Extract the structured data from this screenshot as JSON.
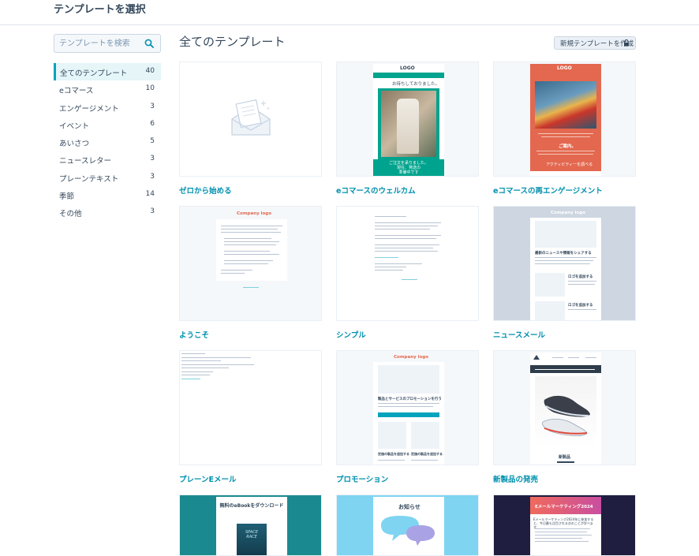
{
  "header": {
    "title": "テンプレートを選択"
  },
  "search": {
    "placeholder": "テンプレートを検索"
  },
  "sidebar": {
    "items": [
      {
        "label": "全てのテンプレート",
        "count": "40",
        "active": true
      },
      {
        "label": "eコマース",
        "count": "10"
      },
      {
        "label": "エンゲージメント",
        "count": "3"
      },
      {
        "label": "イベント",
        "count": "6"
      },
      {
        "label": "あいさつ",
        "count": "5"
      },
      {
        "label": "ニュースレター",
        "count": "3"
      },
      {
        "label": "プレーンテキスト",
        "count": "3"
      },
      {
        "label": "季節",
        "count": "14"
      },
      {
        "label": "その他",
        "count": "3"
      }
    ]
  },
  "main": {
    "title": "全てのテンプレート",
    "create_button": "新規テンプレートを作成",
    "cards": [
      {
        "label": "ゼロから始める"
      },
      {
        "label": "eコマースのウェルカム"
      },
      {
        "label": "eコマースの再エンゲージメント"
      },
      {
        "label": "ようこそ"
      },
      {
        "label": "シンプル"
      },
      {
        "label": "ニュースメール"
      },
      {
        "label": "プレーンEメール"
      },
      {
        "label": "プロモーション"
      },
      {
        "label": "新製品の発売"
      }
    ],
    "thumb_text": {
      "logo": "LOGO",
      "welcome_heading": "お待ちしておりました。",
      "welcome_cta": "ご注文を承りました。\n現在、発送の\n準備中です",
      "reengage_heading": "ご案内。",
      "reengage_cta": "アクティビティーを調べる",
      "company_logo": "Company logo",
      "news_heading": "最新のニュースや情報をシェアする",
      "news_sub1": "ロゴを追加する",
      "news_sub2": "ロゴを追加する",
      "promo_heading": "製品とサービスのプロモーションを行う",
      "promo_left": "定価の製品を追加する",
      "promo_right": "定価の製品を追加する",
      "product_caption": "新製品",
      "ebook_title": "無料のeBookをダウンロード",
      "ebook_cover": "SPACE RACE",
      "notice_title": "お知らせ",
      "seminar_title": "Eメールマーケティング2024",
      "seminar_text": "Eメールマーケティング2024年に参加すると、今日最も注目される次のことが学べます："
    }
  },
  "colors": {
    "accent": "#00a4bd",
    "link": "#0091ae",
    "teal_template": "#00a38d",
    "orange_template": "#e3684f",
    "navy_template": "#1f1e40"
  }
}
